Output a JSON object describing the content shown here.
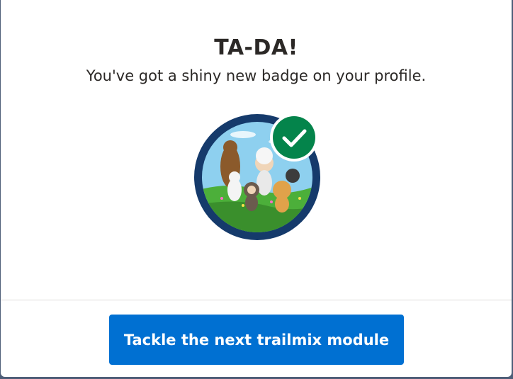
{
  "modal": {
    "title": "TA-DA!",
    "subtitle": "You've got a shiny new badge on your profile.",
    "badge_icon": "trailhead-characters-badge",
    "check_icon": "checkmark-icon",
    "colors": {
      "badge_ring": "#153a6b",
      "check_circle": "#04844b",
      "button": "#0070d2"
    }
  },
  "footer": {
    "cta_label": "Tackle the next trailmix module"
  }
}
